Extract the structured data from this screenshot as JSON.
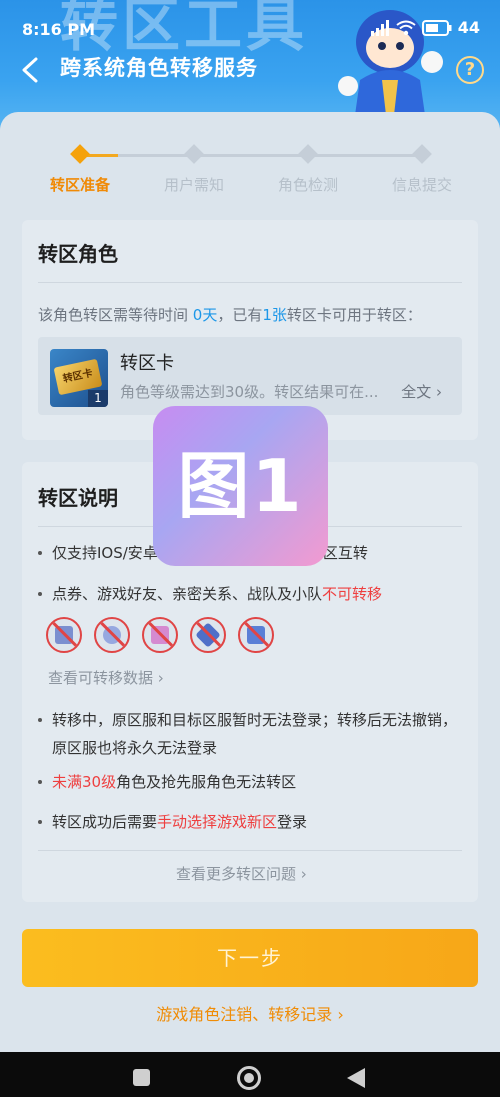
{
  "status_bar": {
    "time": "8:16 PM",
    "battery": "44"
  },
  "header": {
    "big_title": "转区工具",
    "subtitle": "跨系统角色转移服务",
    "help_symbol": "?"
  },
  "stepper": {
    "steps": [
      {
        "label": "转区准备",
        "active": true
      },
      {
        "label": "用户需知",
        "active": false
      },
      {
        "label": "角色检测",
        "active": false
      },
      {
        "label": "信息提交",
        "active": false
      }
    ]
  },
  "role_card": {
    "title": "转区角色",
    "wait_prefix": "该角色转区需等待时间 ",
    "wait_days": "0天",
    "wait_mid": "，已有",
    "card_count_text": "1张",
    "wait_suffix": "转区卡可用于转区：",
    "item": {
      "icon_text": "转区卡",
      "count": "1",
      "name": "转区卡",
      "desc": "角色等级需达到30级。转区结果可在...",
      "more": "全文"
    }
  },
  "info_card": {
    "title": "转区说明",
    "bullet1": "仅支持IOS/安卓",
    "bullet1_tail": "信区互转",
    "bullet2_prefix": "点券、游戏好友、亲密关系、战队及小队",
    "bullet2_red": "不可转移",
    "view_data_link": "查看可转移数据",
    "bullet3": "转移中，原区服和目标区服暂时无法登录；转移后无法撤销，原区服也将永久无法登录",
    "bullet4_red": "未满30级",
    "bullet4_rest": "角色及抢先服角色无法转区",
    "bullet5_prefix": "转区成功后需要",
    "bullet5_red": "手动选择游戏新区",
    "bullet5_suffix": "登录",
    "more_questions": "查看更多转区问题"
  },
  "overlay": {
    "label": "图1"
  },
  "next_button": "下一步",
  "record_link": "游戏角色注销、转移记录"
}
